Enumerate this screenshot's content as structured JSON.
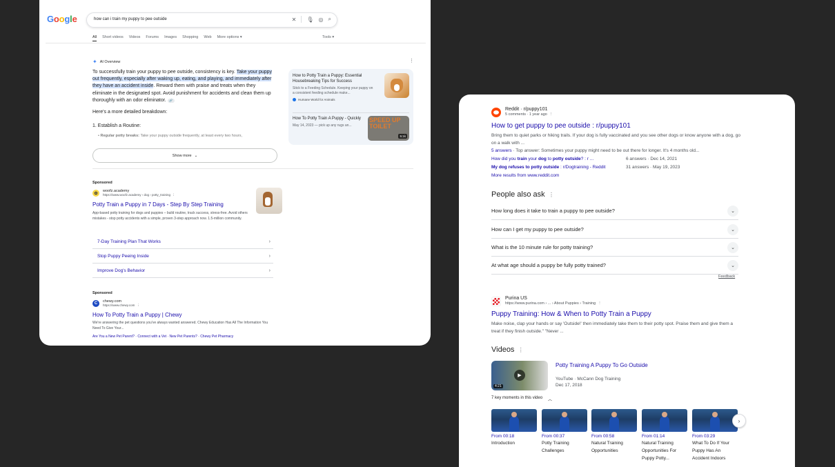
{
  "left": {
    "logo": "Google",
    "search": {
      "query": "how can i train my puppy to pee outside"
    },
    "tabs": [
      "All",
      "Short videos",
      "Videos",
      "Forums",
      "Images",
      "Shopping",
      "Web",
      "More options"
    ],
    "tools": "Tools",
    "ai_overview": {
      "label": "AI Overview",
      "p1_a": "To successfully train your puppy to pee outside, consistency is key. ",
      "p1_hl": "Take your puppy out frequently, especially after waking up, eating, and playing, and immediately after they have an accident inside",
      "p1_b": ". Reward them with praise and treats when they eliminate in the designated spot. Avoid punishment for accidents and clean them up thoroughly with an odor eliminator.",
      "breakdown": "Here's a more detailed breakdown:",
      "step1": "1. Establish a Routine:",
      "bullet_bold": "Regular potty breaks:",
      "bullet_text": " Take your puppy outside frequently, at least every two hours,",
      "show_more": "Show more",
      "sources": [
        {
          "title": "How to Potty Train a Puppy: Essential Housebreaking Tips for Success",
          "desc": "Stick to a Feeding Schedule. Keeping your puppy on a consistent feeding schedule make...",
          "site": "Humane World for Animals"
        },
        {
          "title": "How To Potty Train A Puppy - Quickly",
          "desc": "May 14, 2023 — pick up any rugs an...",
          "thumb_text": "SPEED UP TOILET",
          "badge": "5:1k"
        }
      ]
    },
    "ads": [
      {
        "label": "Sponsored",
        "site": "woofz.academy",
        "url": "https://www.woofz.academy › dog › potty_training",
        "title": "Potty Train a Puppy in 7 Days - Step By Step Training",
        "desc": "App-based potty training for dogs and puppies – build routine, track success, stress-free. Avoid others mistakes - stop potty accidents with a simple, proven 3-step approach now. 1.5-million community.",
        "sitelinks": [
          "7-Day Training Plan That Works",
          "Stop Puppy Peeing Inside",
          "Improve Dog's Behavior"
        ]
      },
      {
        "label": "Sponsored",
        "site": "chewy.com",
        "url": "https://www.chewy.com",
        "title": "How To Potty Train a Puppy | Chewy",
        "desc": "We're answering the pet questions you've always wanted answered. Chewy Education Has All The Information You Need To Give Your...",
        "links": "Are You a New Pet Parent? · Connect with a Vet · New Pet Parents? · Chewy Pet Pharmacy"
      }
    ]
  },
  "right": {
    "reddit": {
      "site": "Reddit · r/puppy101",
      "meta": "5 comments · 1 year ago",
      "title": "How to get puppy to pee outside : r/puppy101",
      "desc": "Bring them to quiet parks or hiking trails. If your dog is fully vaccinated and you see other dogs or know anyone with a dog, go on a walk with ...",
      "answers_link": "5 answers",
      "answers_text": " · Top answer: Sometimes your puppy might need to be out there for longer. It's 4 months old...",
      "subs": [
        {
          "a": "How did you ",
          "b": "train",
          "c": " your ",
          "d": "dog",
          "e": " to ",
          "f": "potty outside",
          "g": "? : r ...",
          "meta": "6 answers · Dec 14, 2021"
        },
        {
          "a": "My dog refuses to ",
          "b": "potty outside",
          "c": " : r/Dogtraining - Reddit",
          "meta": "31 answers · May 19, 2023"
        }
      ],
      "more": "More results from www.reddit.com"
    },
    "paa": {
      "title": "People also ask",
      "questions": [
        "How long does it take to train a puppy to pee outside?",
        "How can I get my puppy to pee outside?",
        "What is the 10 minute rule for potty training?",
        "At what age should a puppy be fully potty trained?"
      ],
      "feedback": "Feedback"
    },
    "purina": {
      "site": "Purina US",
      "url": "https://www.purina.com › ... › About Puppies › Training",
      "title": "Puppy Training: How & When to Potty Train a Puppy",
      "desc": "Make noise, clap your hands or say 'Outside!' then immediately take them to their potty spot. Praise them and give them a treat if they finish outside.\" \"Never ..."
    },
    "videos": {
      "title": "Videos",
      "video_title": "Potty Training A Puppy To Go Outside",
      "source": "YouTube · McCann Dog Training",
      "date": "Dec 17, 2018",
      "duration": "4:21",
      "moments_label": "7 key moments in this video",
      "moments": [
        {
          "time": "From 00:18",
          "label": "Introduction"
        },
        {
          "time": "From 00:37",
          "label": "Potty Training Challenges"
        },
        {
          "time": "From 00:58",
          "label": "Natural Training Opportunities"
        },
        {
          "time": "From 01:14",
          "label": "Natural Training Opportunities For Puppy Potty..."
        },
        {
          "time": "From 03:29",
          "label": "What To Do If Your Puppy Has An Accident Indoors"
        }
      ]
    }
  }
}
